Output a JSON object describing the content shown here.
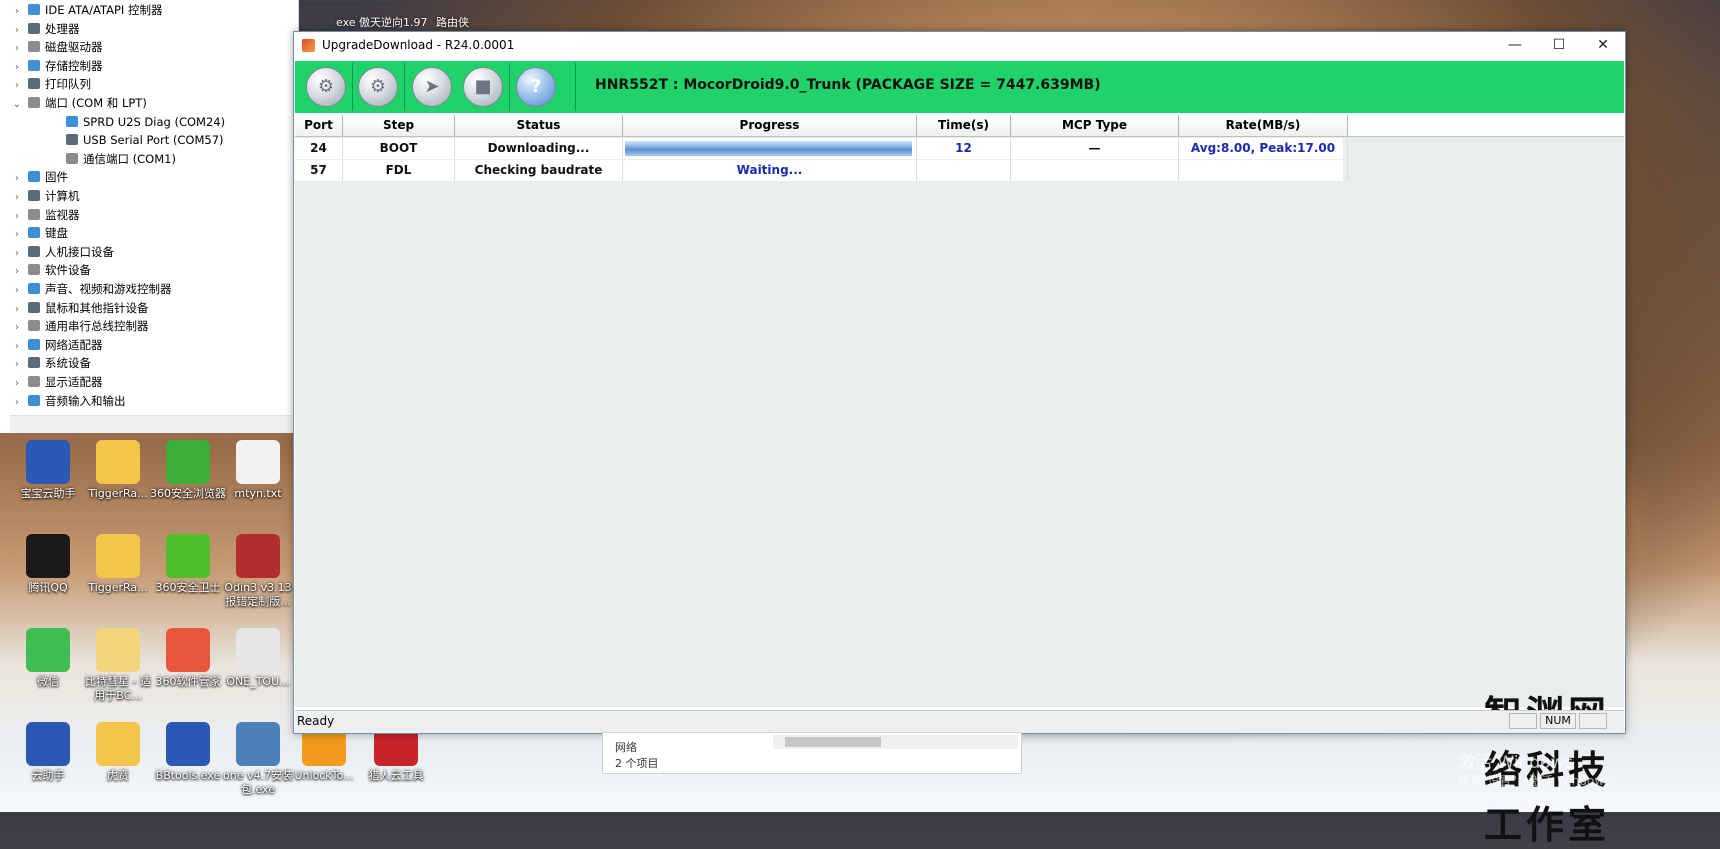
{
  "device_manager": {
    "items": [
      {
        "label": "IDE ATA/ATAPI 控制器",
        "expanded": false
      },
      {
        "label": "处理器",
        "expanded": false
      },
      {
        "label": "磁盘驱动器",
        "expanded": false
      },
      {
        "label": "存储控制器",
        "expanded": false
      },
      {
        "label": "打印队列",
        "expanded": false
      },
      {
        "label": "端口 (COM 和 LPT)",
        "expanded": true
      },
      {
        "label": "SPRD U2S Diag (COM24)",
        "child": true
      },
      {
        "label": "USB Serial Port (COM57)",
        "child": true
      },
      {
        "label": "通信端口 (COM1)",
        "child": true
      },
      {
        "label": "固件",
        "expanded": false
      },
      {
        "label": "计算机",
        "expanded": false
      },
      {
        "label": "监视器",
        "expanded": false
      },
      {
        "label": "键盘",
        "expanded": false
      },
      {
        "label": "人机接口设备",
        "expanded": false
      },
      {
        "label": "软件设备",
        "expanded": false
      },
      {
        "label": "声音、视频和游戏控制器",
        "expanded": false
      },
      {
        "label": "鼠标和其他指针设备",
        "expanded": false
      },
      {
        "label": "通用串行总线控制器",
        "expanded": false
      },
      {
        "label": "网络适配器",
        "expanded": false
      },
      {
        "label": "系统设备",
        "expanded": false
      },
      {
        "label": "显示适配器",
        "expanded": false
      },
      {
        "label": "音频输入和输出",
        "expanded": false
      }
    ]
  },
  "desktop_top_icons": [
    "exe 傲天逆向1.97",
    "路由侠"
  ],
  "desktop_icons": [
    {
      "label": "宝宝云助手",
      "icon": "police-cartoon-icon"
    },
    {
      "label": "TiggerRa...",
      "icon": "folder-icon"
    },
    {
      "label": "360安全浏览器",
      "icon": "browser-360-icon"
    },
    {
      "label": "mtyn.txt",
      "icon": "txt-file-icon"
    },
    {
      "label": "腾讯QQ",
      "icon": "qq-penguin-icon"
    },
    {
      "label": "TiggerRa...",
      "icon": "folder-icon"
    },
    {
      "label": "360安全卫士",
      "icon": "guard-360-icon"
    },
    {
      "label": "Odin3 v3.13 报错定制版...",
      "icon": "odin-icon"
    },
    {
      "label": "微信",
      "icon": "wechat-icon"
    },
    {
      "label": "比特彗星 - 适用于BC...",
      "icon": "folder-doc-icon"
    },
    {
      "label": "360软件管家",
      "icon": "software-360-icon"
    },
    {
      "label": "ONE_TOU...",
      "icon": "gear-app-icon"
    },
    {
      "label": "云助手",
      "icon": "police-cartoon-icon"
    },
    {
      "label": "虎贲",
      "icon": "folder-icon"
    },
    {
      "label": "BBtools.exe",
      "icon": "police-cartoon-icon"
    },
    {
      "label": "one v4.7安装包.exe",
      "icon": "installer-icon"
    },
    {
      "label": "UnlockTo...",
      "icon": "unlock-icon"
    },
    {
      "label": "猎人云工具",
      "icon": "hunter-icon"
    }
  ],
  "window": {
    "title": "UpgradeDownload - R24.0.0001",
    "minimize": "—",
    "maximize": "☐",
    "close": "✕"
  },
  "toolbar": {
    "package_info": "HNR552T : MocorDroid9.0_Trunk (PACKAGE SIZE = 7447.639MB)",
    "buttons": [
      "settings-icon",
      "gears-icon",
      "start-arrow-icon",
      "stop-icon",
      "help-icon"
    ],
    "help_glyph": "?",
    "start_glyph": "➤",
    "stop_glyph": "■",
    "settings_glyph": "⚙",
    "gears_glyph": "⚙"
  },
  "table": {
    "headers": [
      "Port",
      "Step",
      "Status",
      "Progress",
      "Time(s)",
      "MCP Type",
      "Rate(MB/s)"
    ],
    "rows": [
      {
        "port": "24",
        "step": "BOOT",
        "status": "Downloading...",
        "progress_fraction": 0.99,
        "progress_text": "",
        "time": "12",
        "mcp": "—",
        "rate": "Avg:8.00, Peak:17.00"
      },
      {
        "port": "57",
        "step": "FDL",
        "status": "Checking baudrate",
        "progress_fraction": 0,
        "progress_text": "Waiting...",
        "time": "",
        "mcp": "",
        "rate": ""
      }
    ]
  },
  "watermark": "智渊网络科技工作室",
  "statusbar": {
    "status": "Ready",
    "num": "NUM"
  },
  "explorer": {
    "location": "网络",
    "count": "2 个项目"
  },
  "activation": {
    "line1": "激活 Windows",
    "line2": "转到\"设置\"以激活 Windows"
  },
  "colors": {
    "toolbar_green": "#1fd36a",
    "rate_blue": "#1b2bb0"
  }
}
